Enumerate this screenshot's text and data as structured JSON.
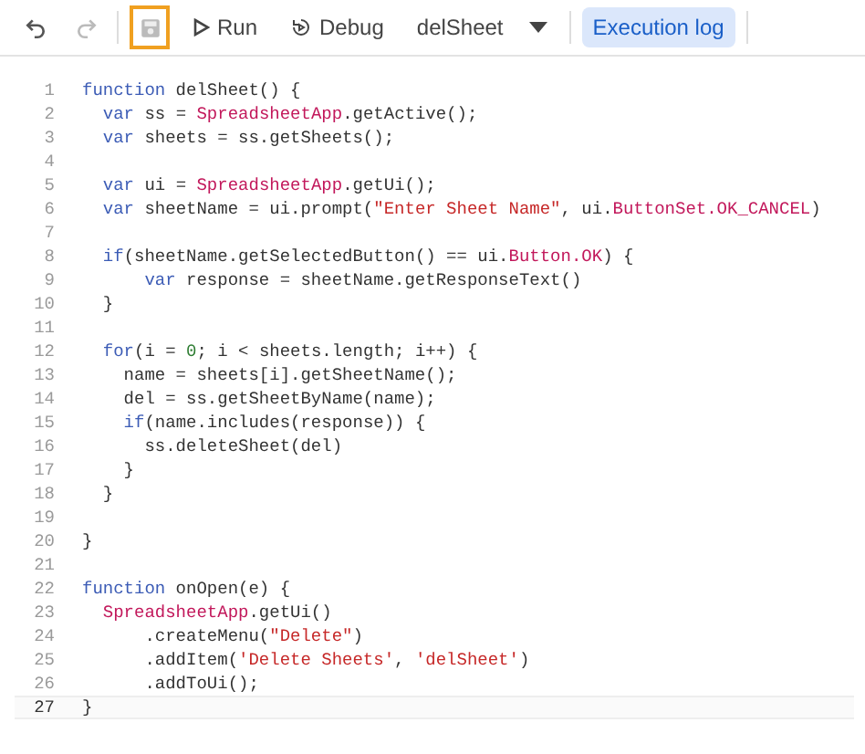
{
  "toolbar": {
    "undo": {
      "disabled": false
    },
    "redo": {
      "disabled": true
    },
    "save": {
      "highlighted": true
    },
    "run": "Run",
    "debug": "Debug",
    "function_select": "delSheet",
    "execution_log": {
      "label": "Execution log",
      "selected": true
    }
  },
  "editor": {
    "lines": [
      {
        "number": "1",
        "tokens": [
          {
            "text": "function",
            "kind": "keyword"
          },
          {
            "text": " delSheet() {",
            "kind": "plain"
          }
        ]
      },
      {
        "number": "2",
        "tokens": [
          {
            "text": "  var",
            "kind": "keyword"
          },
          {
            "text": " ss = ",
            "kind": "plain"
          },
          {
            "text": "SpreadsheetApp",
            "kind": "class"
          },
          {
            "text": ".getActive();",
            "kind": "plain"
          }
        ]
      },
      {
        "number": "3",
        "tokens": [
          {
            "text": "  var",
            "kind": "keyword"
          },
          {
            "text": " sheets = ss.getSheets();",
            "kind": "plain"
          }
        ]
      },
      {
        "number": "4"
      },
      {
        "number": "5",
        "tokens": [
          {
            "text": "  var",
            "kind": "keyword"
          },
          {
            "text": " ui = ",
            "kind": "plain"
          },
          {
            "text": "SpreadsheetApp",
            "kind": "class"
          },
          {
            "text": ".getUi();",
            "kind": "plain"
          }
        ]
      },
      {
        "number": "6",
        "tokens": [
          {
            "text": "  var",
            "kind": "keyword"
          },
          {
            "text": " sheetName = ui.prompt(",
            "kind": "plain"
          },
          {
            "text": "\"Enter Sheet Name\"",
            "kind": "string"
          },
          {
            "text": ", ui.",
            "kind": "plain"
          },
          {
            "text": "ButtonSet.OK_CANCEL",
            "kind": "class"
          },
          {
            "text": ")",
            "kind": "plain"
          }
        ]
      },
      {
        "number": "7"
      },
      {
        "number": "8",
        "tokens": [
          {
            "text": "  if",
            "kind": "keyword"
          },
          {
            "text": "(sheetName.getSelectedButton() == ui.",
            "kind": "plain"
          },
          {
            "text": "Button.OK",
            "kind": "class"
          },
          {
            "text": ") {",
            "kind": "plain"
          }
        ]
      },
      {
        "number": "9",
        "tokens": [
          {
            "text": "      var",
            "kind": "keyword"
          },
          {
            "text": " response = sheetName.getResponseText()",
            "kind": "plain"
          }
        ]
      },
      {
        "number": "10",
        "tokens": [
          {
            "text": "  }",
            "kind": "plain"
          }
        ]
      },
      {
        "number": "11"
      },
      {
        "number": "12",
        "tokens": [
          {
            "text": "  for",
            "kind": "keyword"
          },
          {
            "text": "(i = ",
            "kind": "plain"
          },
          {
            "text": "0",
            "kind": "number"
          },
          {
            "text": "; i < sheets.length; i++) {",
            "kind": "plain"
          }
        ]
      },
      {
        "number": "13",
        "tokens": [
          {
            "text": "    name = sheets[i].getSheetName();",
            "kind": "plain"
          }
        ]
      },
      {
        "number": "14",
        "tokens": [
          {
            "text": "    del = ss.getSheetByName(name);",
            "kind": "plain"
          }
        ]
      },
      {
        "number": "15",
        "tokens": [
          {
            "text": "    if",
            "kind": "keyword"
          },
          {
            "text": "(name.includes(response)) {",
            "kind": "plain"
          }
        ]
      },
      {
        "number": "16",
        "tokens": [
          {
            "text": "      ss.deleteSheet(del)",
            "kind": "plain"
          }
        ]
      },
      {
        "number": "17",
        "tokens": [
          {
            "text": "    }",
            "kind": "plain"
          }
        ]
      },
      {
        "number": "18",
        "tokens": [
          {
            "text": "  }",
            "kind": "plain"
          }
        ]
      },
      {
        "number": "19"
      },
      {
        "number": "20",
        "tokens": [
          {
            "text": "}",
            "kind": "plain"
          }
        ]
      },
      {
        "number": "21"
      },
      {
        "number": "22",
        "tokens": [
          {
            "text": "function",
            "kind": "keyword"
          },
          {
            "text": " onOpen(e) {",
            "kind": "plain"
          }
        ]
      },
      {
        "number": "23",
        "tokens": [
          {
            "text": "  SpreadsheetApp",
            "kind": "class"
          },
          {
            "text": ".getUi()",
            "kind": "plain"
          }
        ]
      },
      {
        "number": "24",
        "tokens": [
          {
            "text": "      .createMenu(",
            "kind": "plain"
          },
          {
            "text": "\"Delete\"",
            "kind": "string"
          },
          {
            "text": ")",
            "kind": "plain"
          }
        ]
      },
      {
        "number": "25",
        "tokens": [
          {
            "text": "      .addItem(",
            "kind": "plain"
          },
          {
            "text": "'Delete Sheets'",
            "kind": "string"
          },
          {
            "text": ", ",
            "kind": "plain"
          },
          {
            "text": "'delSheet'",
            "kind": "string"
          },
          {
            "text": ")",
            "kind": "plain"
          }
        ]
      },
      {
        "number": "26",
        "tokens": [
          {
            "text": "      .addToUi();",
            "kind": "plain"
          }
        ]
      },
      {
        "number": "27",
        "current": true,
        "tokens": [
          {
            "text": "}",
            "kind": "plain"
          }
        ]
      }
    ]
  }
}
